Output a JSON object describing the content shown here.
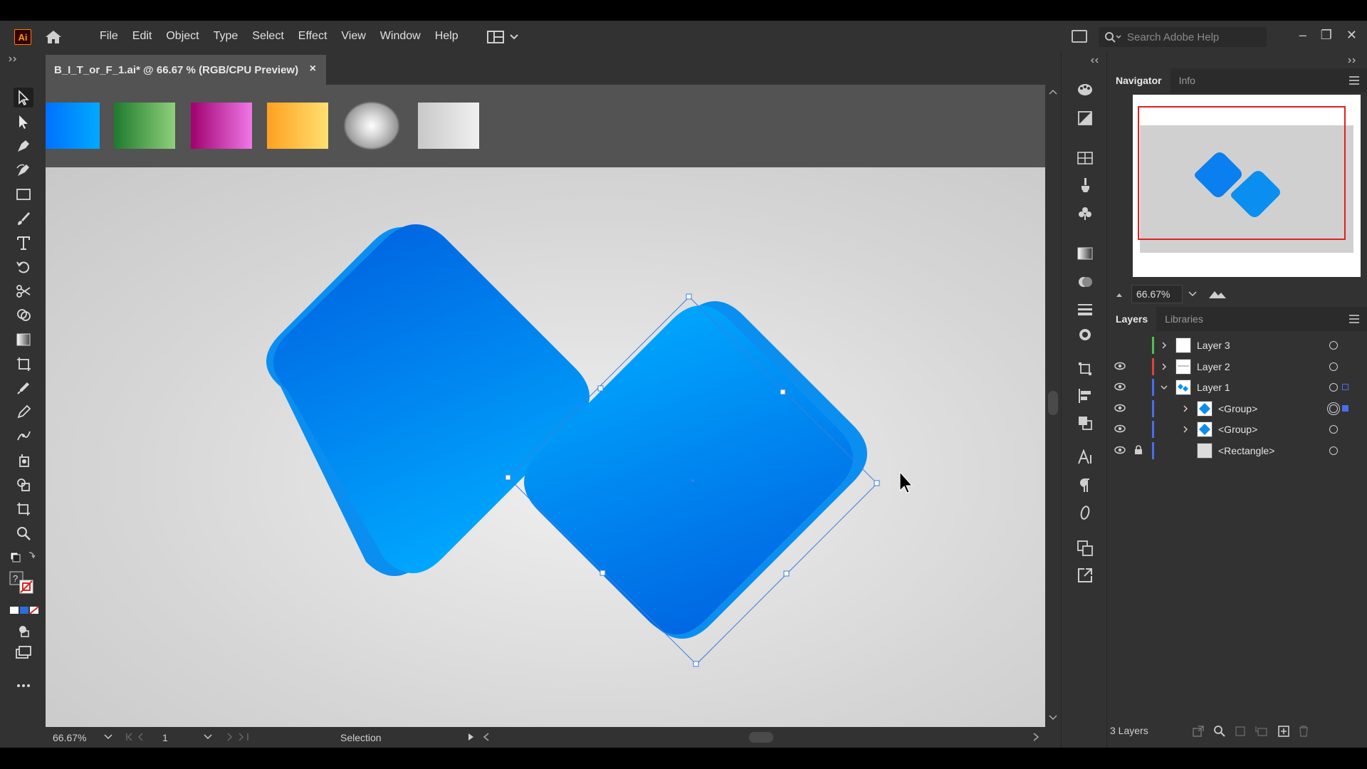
{
  "app": {
    "logo_text": "Ai",
    "menu": [
      "File",
      "Edit",
      "Object",
      "Type",
      "Select",
      "Effect",
      "View",
      "Window",
      "Help"
    ],
    "search_placeholder": "Search Adobe Help"
  },
  "document": {
    "tab_title": "B_I_T_or_F_1.ai* @ 66.67 % (RGB/CPU Preview)",
    "close_glyph": "×"
  },
  "swatches": [
    {
      "name": "blue",
      "from": "#0066ff",
      "to": "#00aaff"
    },
    {
      "name": "green",
      "from": "#1e7a2e",
      "to": "#8fd07a"
    },
    {
      "name": "magenta",
      "from": "#a0006e",
      "to": "#f078e8"
    },
    {
      "name": "orange-yellow",
      "from": "#ffa020",
      "to": "#ffe070"
    },
    {
      "name": "radial-white",
      "from": "#ffffff",
      "to": "#8a8a8a"
    },
    {
      "name": "light-gray",
      "from": "#c8c8c8",
      "to": "#f0f0f0"
    }
  ],
  "colors": {
    "shape_dark": "#0062e0",
    "shape_light": "#00aaff",
    "selection": "#2d7be0",
    "navigator_frame": "#e02020"
  },
  "statusbar": {
    "zoom": "66.67%",
    "artboard": "1",
    "tool_name": "Selection"
  },
  "navigator": {
    "tab_active": "Navigator",
    "tab_other": "Info",
    "zoom": "66.67%"
  },
  "layers_panel": {
    "tab_active": "Layers",
    "tab_other": "Libraries",
    "rows": [
      {
        "name": "Layer 3",
        "color": "#4ec24e",
        "visible": false,
        "locked": false
      },
      {
        "name": "Layer 2",
        "color": "#e04040",
        "visible": true,
        "locked": false
      },
      {
        "name": "Layer 1",
        "color": "#4a6cf0",
        "visible": true,
        "locked": false
      },
      {
        "name": "<Group>",
        "color": "#4a6cf0",
        "visible": true,
        "locked": false
      },
      {
        "name": "<Group>",
        "color": "#4a6cf0",
        "visible": true,
        "locked": false
      },
      {
        "name": "<Rectangle>",
        "color": "#4a6cf0",
        "visible": true,
        "locked": true
      }
    ],
    "footer": "3 Layers"
  }
}
